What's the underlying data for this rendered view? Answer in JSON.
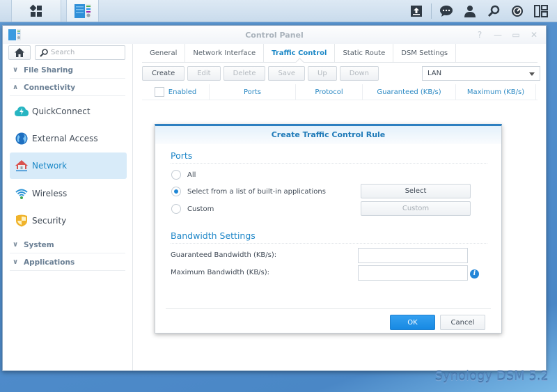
{
  "taskbar": {
    "left_icons": [
      "main-menu-icon",
      "control-panel-icon"
    ],
    "right_icons": [
      "upload-icon",
      "notifications-icon",
      "user-icon",
      "search-icon",
      "resource-monitor-icon",
      "widgets-icon"
    ]
  },
  "window": {
    "title": "Control Panel",
    "controls": [
      "help-icon",
      "minimize-icon",
      "maximize-icon",
      "close-icon"
    ]
  },
  "sidebar": {
    "search_placeholder": "Search",
    "groups": [
      {
        "label": "File Sharing",
        "expanded": false
      },
      {
        "label": "Connectivity",
        "expanded": true
      },
      {
        "label": "System",
        "expanded": false
      },
      {
        "label": "Applications",
        "expanded": false
      }
    ],
    "items": [
      {
        "label": "QuickConnect",
        "icon": "quickconnect-icon"
      },
      {
        "label": "External Access",
        "icon": "globe-icon"
      },
      {
        "label": "Network",
        "icon": "network-house-icon",
        "active": true
      },
      {
        "label": "Wireless",
        "icon": "wifi-icon"
      },
      {
        "label": "Security",
        "icon": "shield-icon"
      }
    ]
  },
  "tabs": [
    {
      "label": "General"
    },
    {
      "label": "Network Interface"
    },
    {
      "label": "Traffic Control",
      "active": true
    },
    {
      "label": "Static Route"
    },
    {
      "label": "DSM Settings"
    }
  ],
  "toolbar": {
    "create": "Create",
    "edit": "Edit",
    "delete": "Delete",
    "save": "Save",
    "up": "Up",
    "down": "Down",
    "interface_select": "LAN"
  },
  "grid": {
    "columns": [
      "Enabled",
      "Ports",
      "Protocol",
      "Guaranteed (KB/s)",
      "Maximum (KB/s)"
    ]
  },
  "dialog": {
    "title": "Create Traffic Control Rule",
    "ports_section": "Ports",
    "radio_all": "All",
    "radio_builtin": "Select from a list of built-in applications",
    "radio_custom": "Custom",
    "selected_radio": "builtin",
    "select_button": "Select",
    "custom_button": "Custom",
    "bandwidth_section": "Bandwidth Settings",
    "guaranteed_label": "Guaranteed Bandwidth (KB/s):",
    "guaranteed_value": "",
    "maximum_label": "Maximum Bandwidth (KB/s):",
    "maximum_value": "",
    "ok": "OK",
    "cancel": "Cancel"
  },
  "watermark": "Synology DSM 5.2",
  "colors": {
    "accent": "#1f87c8",
    "primary_button": "#1789e3",
    "desktop": "#4f8ccb"
  }
}
